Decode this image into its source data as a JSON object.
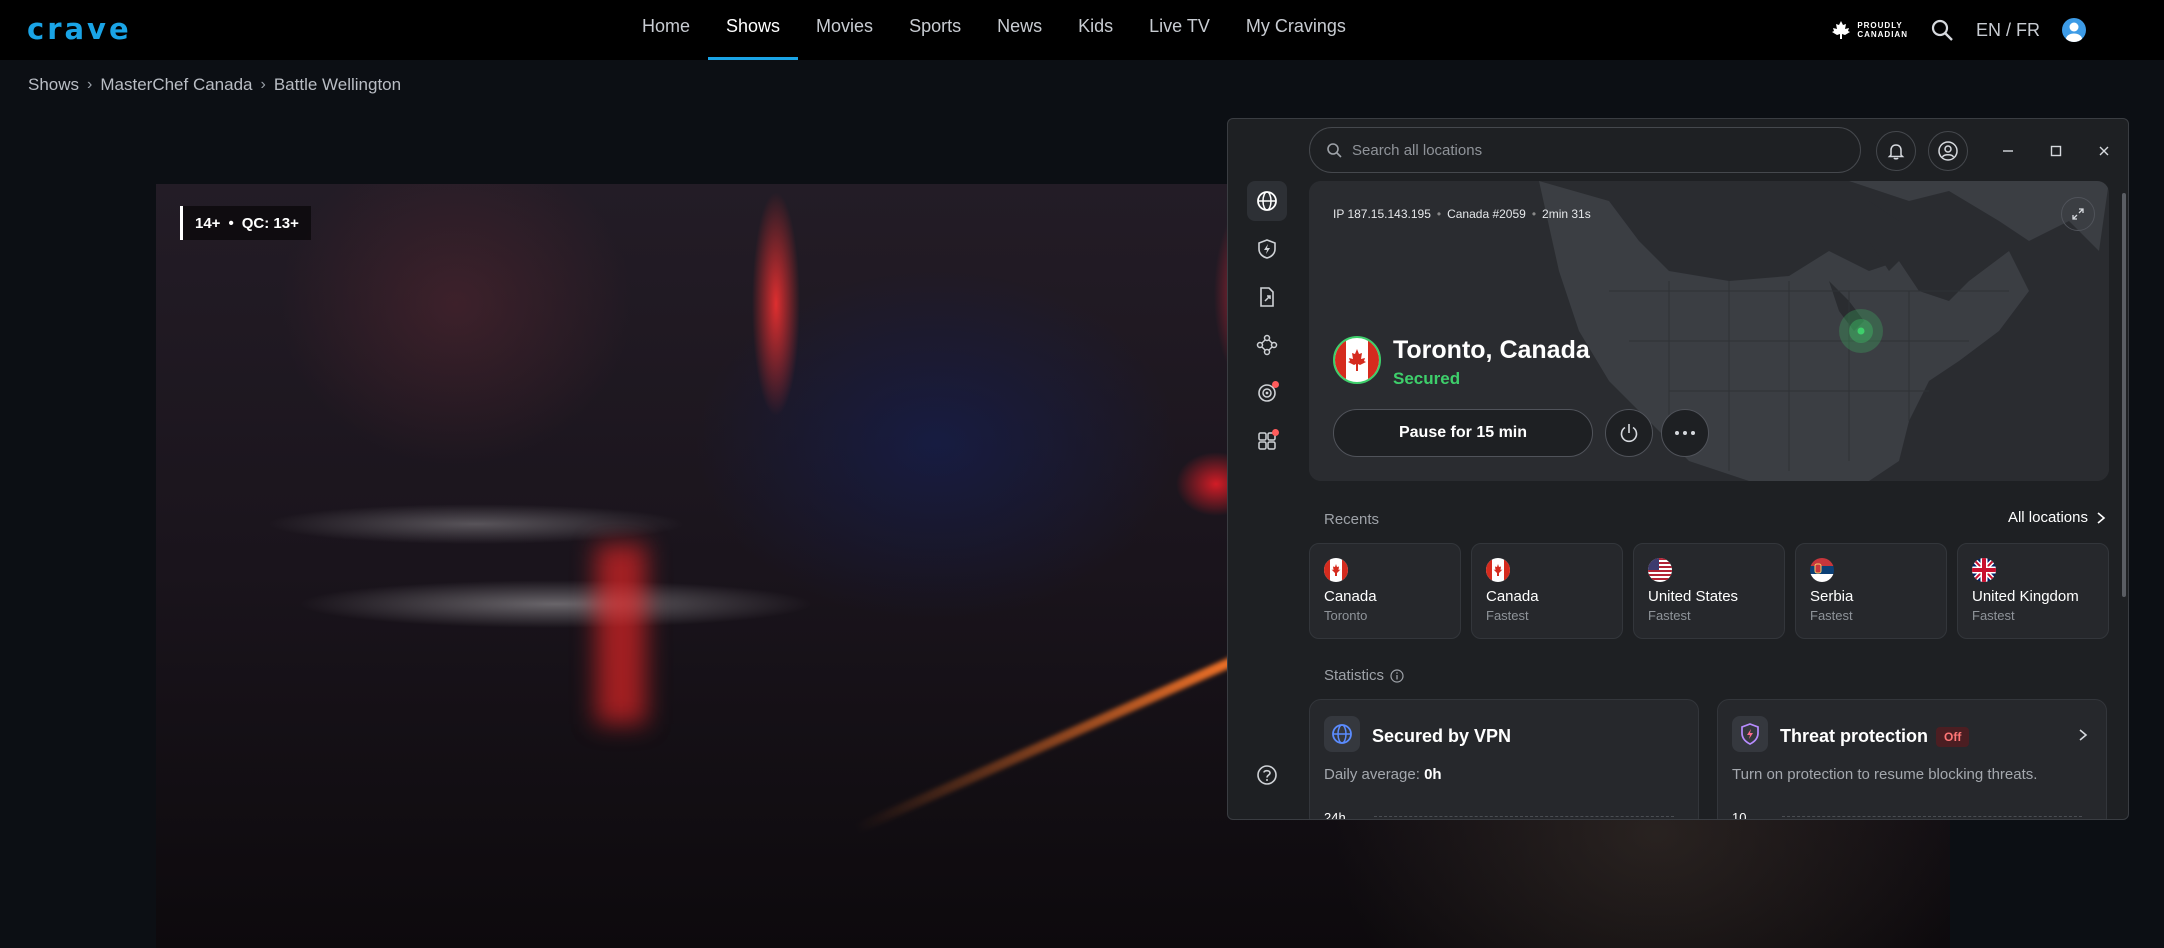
{
  "nav": {
    "logo": "crave",
    "links": [
      "Home",
      "Shows",
      "Movies",
      "Sports",
      "News",
      "Kids",
      "Live TV",
      "My Cravings"
    ],
    "active": "Shows",
    "proudly_line1": "PROUDLY",
    "proudly_line2": "CANADIAN",
    "lang": "EN / FR"
  },
  "breadcrumb": [
    "Shows",
    "MasterChef Canada",
    "Battle Wellington"
  ],
  "video": {
    "rating": "14+",
    "rating_sep": "•",
    "qc_rating": "QC: 13+"
  },
  "vpn": {
    "search_placeholder": "Search all locations",
    "ip": "IP 187.15.143.195",
    "server": "Canada #2059",
    "duration": "2min 31s",
    "location": "Toronto, Canada",
    "status": "Secured",
    "pause_label": "Pause for 15 min",
    "recents_label": "Recents",
    "all_locations": "All locations",
    "recents": [
      {
        "country": "Canada",
        "sub": "Toronto",
        "flag": "ca"
      },
      {
        "country": "Canada",
        "sub": "Fastest",
        "flag": "ca"
      },
      {
        "country": "United States",
        "sub": "Fastest",
        "flag": "us"
      },
      {
        "country": "Serbia",
        "sub": "Fastest",
        "flag": "rs"
      },
      {
        "country": "United Kingdom",
        "sub": "Fastest",
        "flag": "gb"
      }
    ],
    "statistics_label": "Statistics",
    "stat_vpn": {
      "title": "Secured by VPN",
      "desc_prefix": "Daily average:",
      "desc_value": "0h",
      "chart_label": "24h"
    },
    "stat_threat": {
      "title": "Threat protection",
      "badge": "Off",
      "desc": "Turn on protection to resume blocking threats.",
      "chart_label": "10"
    },
    "colors": {
      "secured": "#3ecf6b",
      "accent": "#1aa4e6",
      "off": "#ff7676"
    }
  }
}
